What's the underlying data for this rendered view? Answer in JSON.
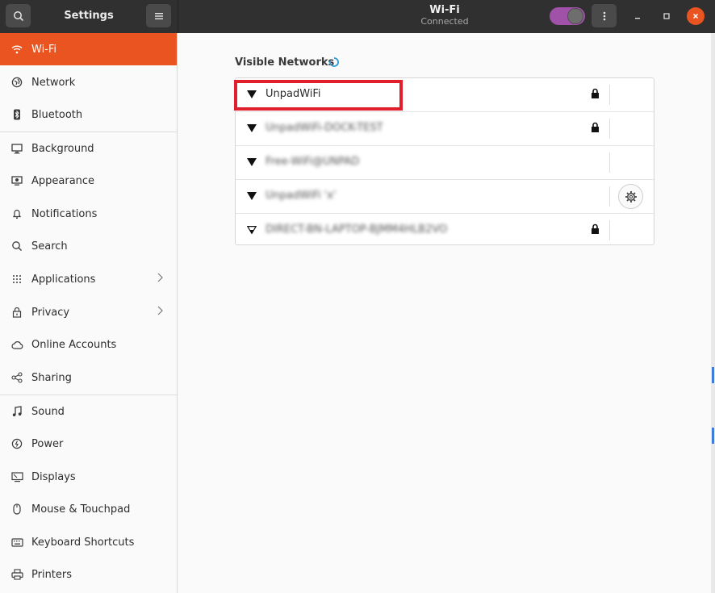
{
  "header": {
    "settings_title": "Settings",
    "window_title": "Wi-Fi",
    "window_subtitle": "Connected",
    "wifi_toggle_on": true
  },
  "sidebar": {
    "items": [
      {
        "label": "Wi-Fi",
        "icon": "wifi-icon",
        "active": true
      },
      {
        "label": "Network",
        "icon": "network-icon"
      },
      {
        "label": "Bluetooth",
        "icon": "bluetooth-icon"
      },
      {
        "label": "Background",
        "icon": "background-icon"
      },
      {
        "label": "Appearance",
        "icon": "appearance-icon"
      },
      {
        "label": "Notifications",
        "icon": "bell-icon"
      },
      {
        "label": "Search",
        "icon": "search-icon"
      },
      {
        "label": "Applications",
        "icon": "grid-icon",
        "has_chevron": true
      },
      {
        "label": "Privacy",
        "icon": "lock-icon",
        "has_chevron": true
      },
      {
        "label": "Online Accounts",
        "icon": "cloud-icon"
      },
      {
        "label": "Sharing",
        "icon": "share-icon"
      },
      {
        "label": "Sound",
        "icon": "music-note-icon"
      },
      {
        "label": "Power",
        "icon": "power-icon"
      },
      {
        "label": "Displays",
        "icon": "display-icon"
      },
      {
        "label": "Mouse & Touchpad",
        "icon": "mouse-icon"
      },
      {
        "label": "Keyboard Shortcuts",
        "icon": "keyboard-icon"
      },
      {
        "label": "Printers",
        "icon": "printer-icon"
      }
    ]
  },
  "main": {
    "visible_networks_title": "Visible Networks",
    "networks": [
      {
        "name": "UnpadWiFi",
        "locked": true,
        "blurred": false,
        "signal": "full"
      },
      {
        "name": "UnpadWiFi-DOCK-TEST",
        "locked": true,
        "blurred": true,
        "signal": "full"
      },
      {
        "name": "Free-WiFi@UNPAD",
        "locked": false,
        "blurred": true,
        "signal": "full"
      },
      {
        "name": "UnpadWiFi 'x'",
        "locked": false,
        "blurred": true,
        "signal": "full",
        "connected": true
      },
      {
        "name": "DIRECT-BN-LAPTOP-BJMM4HLB2VO",
        "locked": true,
        "blurred": true,
        "signal": "weak"
      }
    ]
  },
  "colors": {
    "accent": "#e95420",
    "header_bg": "#303030",
    "toggle_on": "#a052a8",
    "highlight_box": "#e01e2c"
  }
}
